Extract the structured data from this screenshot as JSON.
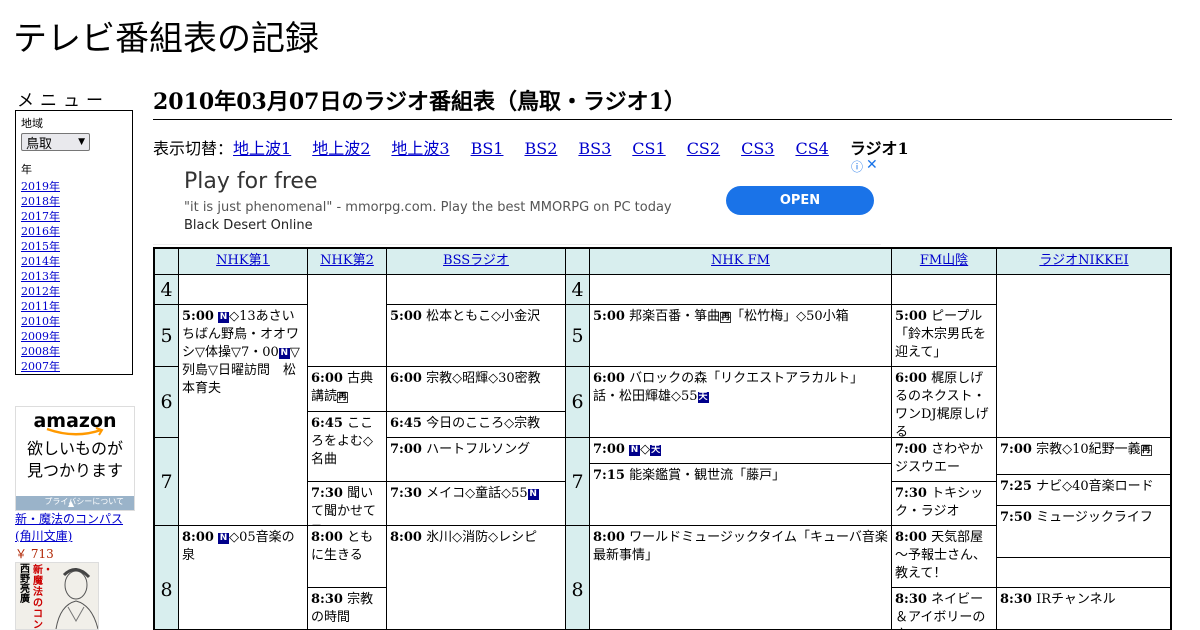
{
  "site": {
    "title": "テレビ番組表の記録"
  },
  "sidebar": {
    "heading": "メニュー",
    "region_label": "地域",
    "region_value": "鳥取",
    "year_label": "年",
    "years": [
      "2019年",
      "2018年",
      "2017年",
      "2016年",
      "2015年",
      "2014年",
      "2013年",
      "2012年",
      "2011年",
      "2010年",
      "2009年",
      "2008年",
      "2007年"
    ],
    "amazon_ad": {
      "logo": "amazon",
      "message_1": "欲しいものが",
      "message_2": "見つかります",
      "privacy": "プライバシーについて"
    },
    "book": {
      "title": "新・魔法のコンパス (角川文庫)",
      "price": "￥ 713",
      "cover_text": "新・魔法のコンパス",
      "cover_author": "西野亮廣"
    }
  },
  "main": {
    "title": "2010年03月07日のラジオ番組表（鳥取・ラジオ1）",
    "switch_label": "表示切替：",
    "switch_links": [
      "地上波1",
      "地上波2",
      "地上波3",
      "BS1",
      "BS2",
      "BS3",
      "CS1",
      "CS2",
      "CS3",
      "CS4"
    ],
    "switch_current": "ラジオ1"
  },
  "ad_banner": {
    "headline": "Play for free",
    "description_pre": "\"it is just phenomenal\" - mmorpg.com. Play the best MMORPG on PC today ",
    "description_em": "Black Desert Online",
    "button": "OPEN",
    "info_icon": "info-icon",
    "close_icon": "close-icon"
  },
  "schedule": {
    "channels": [
      "NHK第1",
      "NHK第2",
      "BSSラジオ",
      "NHK FM",
      "FM山陰",
      "ラジオNIKKEI"
    ],
    "hours": [
      "4",
      "5",
      "6",
      "7",
      "8"
    ],
    "badge_labels": {
      "n": "N",
      "o": "再",
      "s": "天"
    },
    "programs": {
      "nhk1_500": {
        "time": "5:00",
        "title_a": "◇13あさいちばん野鳥・オオワシ▽体操▽7・00",
        "title_b": "▽列島▽日曜訪問　松本育夫"
      },
      "nhk1_800": {
        "time": "8:00",
        "title": "◇05音楽の泉"
      },
      "nhk2_600": {
        "time": "6:00",
        "title": "古典講読"
      },
      "nhk2_645": {
        "time": "6:45",
        "title": "こころをよむ◇名曲"
      },
      "nhk2_730": {
        "time": "7:30",
        "title": "聞いて聞かせて"
      },
      "nhk2_800": {
        "time": "8:00",
        "title": "ともに生きる"
      },
      "nhk2_830": {
        "time": "8:30",
        "title": "宗教の時間"
      },
      "bss_500": {
        "time": "5:00",
        "title": "松本ともこ◇小金沢"
      },
      "bss_600": {
        "time": "6:00",
        "title": "宗教◇昭輝◇30密教"
      },
      "bss_645": {
        "time": "6:45",
        "title": "今日のこころ◇宗教"
      },
      "bss_700": {
        "time": "7:00",
        "title": "ハートフルソング"
      },
      "bss_730": {
        "time": "7:30",
        "title": "メイコ◇童話◇55"
      },
      "bss_800": {
        "time": "8:00",
        "title": "氷川◇消防◇レシピ"
      },
      "fm_500": {
        "time": "5:00",
        "title": "邦楽百番・箏曲",
        "title_b": "「松竹梅」◇50小箱"
      },
      "fm_600": {
        "time": "6:00",
        "title": "バロックの森「リクエストアラカルト」話・松田輝雄◇55"
      },
      "fm_700": {
        "time": "7:00",
        "title": "◇"
      },
      "fm_715": {
        "time": "7:15",
        "title": "能楽鑑賞・観世流「藤戸」"
      },
      "fm_800": {
        "time": "8:00",
        "title": "ワールドミュージックタイム「キューバ音楽最新事情」"
      },
      "fms_500": {
        "time": "5:00",
        "title": "ピープル「鈴木宗男氏を迎えて」"
      },
      "fms_600": {
        "time": "6:00",
        "title": "梶原しげるのネクスト・ワンDJ梶原しげる"
      },
      "fms_700": {
        "time": "7:00",
        "title": "さわやかジスウエー"
      },
      "fms_730": {
        "time": "7:30",
        "title": "トキシック・ラジオ"
      },
      "fms_800": {
        "time": "8:00",
        "title": "天気部屋～予報士さん、教えて！"
      },
      "fms_830": {
        "time": "8:30",
        "title": "ネイビー＆アイボリーの恋"
      },
      "nk_700": {
        "time": "7:00",
        "title": "宗教◇10紀野一義"
      },
      "nk_725": {
        "time": "7:25",
        "title": "ナビ◇40音楽ロード"
      },
      "nk_750": {
        "time": "7:50",
        "title": "ミュージックライフ"
      },
      "nk_830": {
        "time": "8:30",
        "title": "IRチャンネル"
      }
    }
  }
}
